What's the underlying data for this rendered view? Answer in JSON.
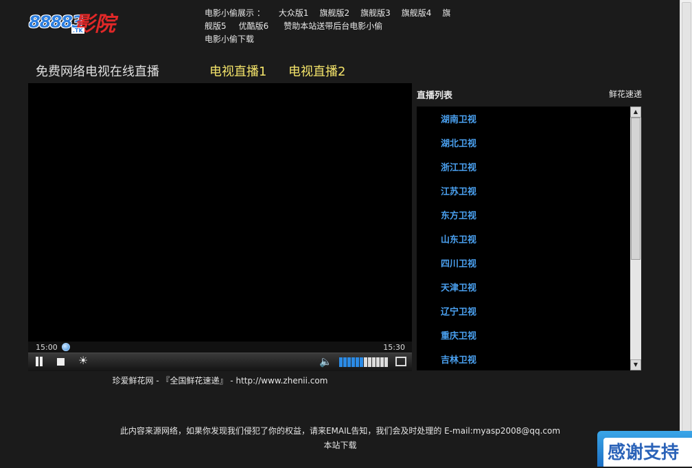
{
  "logo": {
    "digits": "88883",
    "text": "影院",
    "suffix": ".TK"
  },
  "topnav": {
    "lead": "电影小偷展示 ：",
    "links": [
      "大众版1",
      "旗舰版2",
      "旗舰版3",
      "旗舰版4",
      "旗舰版5",
      "优酷版6",
      "赞助本站送带后台电影小偷",
      "电影小偷下载"
    ]
  },
  "page_title": "免费网络电视在线直播",
  "live_links": [
    "电视直播1",
    "电视直播2"
  ],
  "player": {
    "time_start": "15:00",
    "time_end": "15:30",
    "volume_level": 0.5,
    "progress": 0.0
  },
  "credit": "珍爱鲜花网 - 『全国鲜花速递』 - http://www.zhenii.com",
  "channel_list": {
    "title": "直播列表",
    "side_link": "鲜花速递",
    "channels": [
      "湖南卫视",
      "湖北卫视",
      "浙江卫视",
      "江苏卫视",
      "东方卫视",
      "山东卫视",
      "四川卫视",
      "天津卫视",
      "辽宁卫视",
      "重庆卫视",
      "吉林卫视"
    ]
  },
  "footer": {
    "disclaimer": "此内容来源网络，如果你发现我们侵犯了你的权益，请来EMAIL告知，我们会及时处理的 E-mail:myasp2008@qq.com",
    "download": "本站下载"
  },
  "badge": {
    "text": "感谢支持"
  },
  "colors": {
    "background": "#1b1b1b",
    "accent_yellow": "#f3e36a",
    "channel_blue": "#4aa0ef"
  }
}
